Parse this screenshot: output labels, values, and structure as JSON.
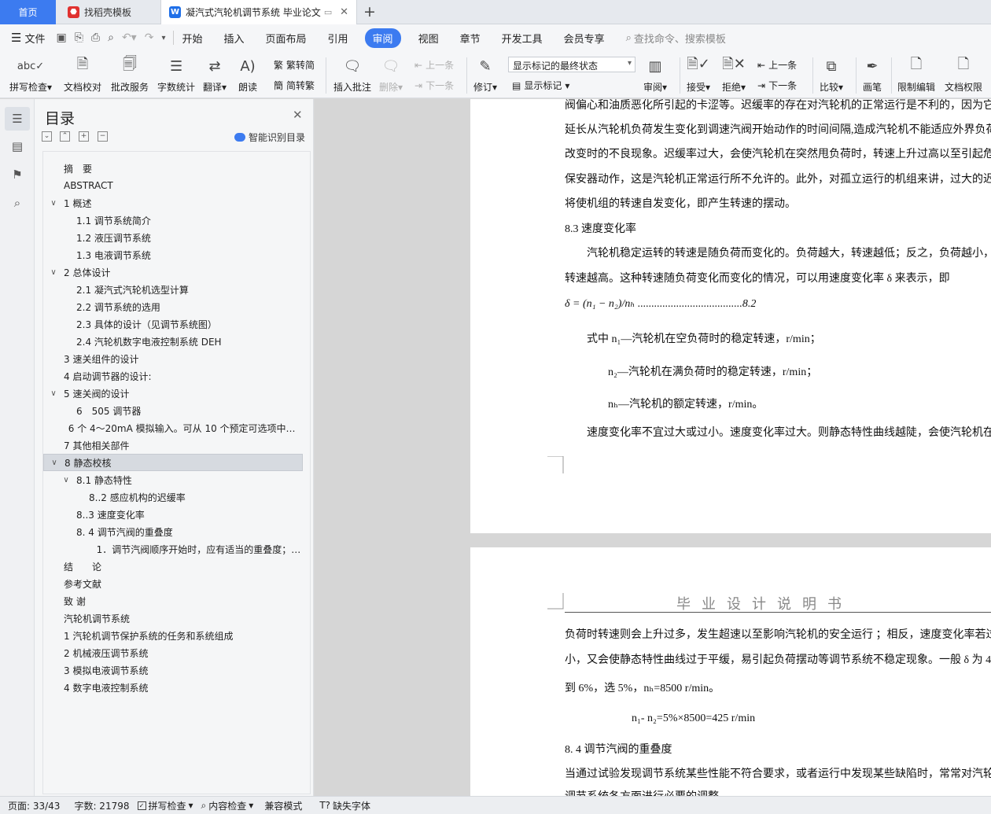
{
  "tabs": [
    {
      "label": "首页"
    },
    {
      "label": "找稻壳模板"
    },
    {
      "label": "凝汽式汽轮机调节系统 毕业论文"
    }
  ],
  "menu": {
    "file_label": "文件",
    "items": [
      "开始",
      "插入",
      "页面布局",
      "引用",
      "审阅",
      "视图",
      "章节",
      "开发工具",
      "会员专享"
    ],
    "active": "审阅",
    "search_placeholder": "查找命令、搜索模板"
  },
  "ribbon": {
    "spellcheck": "拼写检查",
    "doc_check": "文档校对",
    "batch_service": "批改服务",
    "word_count": "字数统计",
    "translate": "翻译",
    "read_aloud": "朗读",
    "trad_to_simp": "繁转简",
    "simp_to_trad": "简转繁",
    "insert_comment": "插入批注",
    "delete": "删除",
    "prev_comment": "上一条",
    "next_comment": "下一条",
    "track_changes": "修订",
    "display_mode": "显示标记的最终状态",
    "show_markup": "显示标记",
    "review": "审阅",
    "accept": "接受",
    "reject": "拒绝",
    "prev_change": "上一条",
    "next_change": "下一条",
    "compare": "比较",
    "pen": "画笔",
    "restrict_edit": "限制编辑",
    "doc_permission": "文档权限"
  },
  "toc": {
    "title": "目录",
    "smart_label": "智能识别目录",
    "items": [
      {
        "text": "摘　要",
        "level": 0,
        "chevron": ""
      },
      {
        "text": "ABSTRACT",
        "level": 0,
        "chevron": ""
      },
      {
        "text": "1  概述",
        "level": 0,
        "chevron": "v"
      },
      {
        "text": "1.1 调节系统简介",
        "level": 1,
        "chevron": ""
      },
      {
        "text": "1.2 液压调节系统",
        "level": 1,
        "chevron": ""
      },
      {
        "text": "1.3 电液调节系统",
        "level": 1,
        "chevron": ""
      },
      {
        "text": "2  总体设计",
        "level": 0,
        "chevron": "v"
      },
      {
        "text": "2.1 凝汽式汽轮机选型计算",
        "level": 1,
        "chevron": ""
      },
      {
        "text": "2.2 调节系统的选用",
        "level": 1,
        "chevron": ""
      },
      {
        "text": "2.3 具体的设计（见调节系统图）",
        "level": 1,
        "chevron": ""
      },
      {
        "text": "2.4 汽轮机数字电液控制系统 DEH",
        "level": 1,
        "chevron": ""
      },
      {
        "text": "3 速关组件的设计",
        "level": 0,
        "chevron": ""
      },
      {
        "text": "4 启动调节器的设计:",
        "level": 0,
        "chevron": ""
      },
      {
        "text": "5 速关阀的设计",
        "level": 0,
        "chevron": "v"
      },
      {
        "text": "6　505 调节器",
        "level": 1,
        "chevron": ""
      },
      {
        "text": "6 个 4～20mA 模拟输入。可从 10 个预定可选项中选择...",
        "level": 0.4,
        "chevron": ""
      },
      {
        "text": "7  其他相关部件",
        "level": 0,
        "chevron": ""
      },
      {
        "text": "8 静态校核",
        "level": 0,
        "chevron": "v"
      },
      {
        "text": "8.1 静态特性",
        "level": 1,
        "chevron": "v"
      },
      {
        "text": "8..2 感应机构的迟缓率",
        "level": 2,
        "chevron": ""
      },
      {
        "text": "8..3 速度变化率",
        "level": 1,
        "chevron": ""
      },
      {
        "text": "8. 4 调节汽阀的重叠度",
        "level": 1,
        "chevron": ""
      },
      {
        "text": "1．调节汽阀顺序开始时，应有适当的重叠度； ...",
        "level": 2.6,
        "chevron": ""
      },
      {
        "text": "结　　论",
        "level": 0,
        "chevron": ""
      },
      {
        "text": "参考文献",
        "level": 0,
        "chevron": ""
      },
      {
        "text": "致  谢",
        "level": 0,
        "chevron": ""
      },
      {
        "text": "汽轮机调节系统",
        "level": 0,
        "chevron": ""
      },
      {
        "text": "1 汽轮机调节保护系统的任务和系统组成",
        "level": 0,
        "chevron": ""
      },
      {
        "text": "2 机械液压调节系统",
        "level": 0,
        "chevron": ""
      },
      {
        "text": "3 模拟电液调节系统",
        "level": 0,
        "chevron": ""
      },
      {
        "text": "4  数字电液控制系统",
        "level": 0,
        "chevron": ""
      }
    ],
    "selected_index": 17
  },
  "page1": {
    "lines": [
      "阀偏心和油质恶化所引起的卡涩等。迟缓率的存在对汽轮机的正常运行是不利的，因为它会",
      "延长从汽轮机负荷发生变化到调速汽阀开始动作的时间间隔,造成汽轮机不能适应外界负荷",
      "改变时的不良现象。迟缓率过大，会使汽轮机在突然甩负荷时，转速上升过高以至引起危急",
      "保安器动作，这是汽轮机正常运行所不允许的。此外，对孤立运行的机组来讲，过大的迟缓",
      "将使机组的转速自发变化，即产生转速的摆动。"
    ],
    "heading_83": "8.3 速度变化率",
    "para_83_1": "汽轮机稳定运转的转速是随负荷而变化的。负荷越大，转速越低；反之，负荷越小，则",
    "para_83_2": "转速越高。这种转速随负荷变化而变化的情况，可以用速度变化率 δ 来表示，即",
    "formula": "δ = (n₁ − n₂)/nₕ ......................................8.2",
    "where_1": "式中 n₁—汽轮机在空负荷时的稳定转速，r/min；",
    "where_2": "n₂—汽轮机在满负荷时的稳定转速，r/min；",
    "where_3": "nₕ—汽轮机的额定转速，r/min。",
    "last_line": "速度变化率不宜过大或过小。速度变化率过大。则静态特性曲线越陡，会使汽轮机在扩"
  },
  "page2": {
    "header": "毕业设计说明书",
    "line_1": "负荷时转速则会上升过多，发生超速以至影响汽轮机的安全运行 ；相反，速度变化率若过",
    "line_2": "小，又会使静态特性曲线过于平缓，易引起负荷摆动等调节系统不稳定现象。一般 δ 为 4",
    "line_3": "到 6%，选 5%，nₕ=8500 r/min。",
    "formula": "n₁- n₂=5%×8500=425 r/min",
    "heading_84": "8. 4 调节汽阀的重叠度",
    "line_4": "当通过试验发现调节系统某些性能不符合要求，或者运行中发现某些缺陷时，常常对汽轮",
    "line_5": "调节系统各方面进行必要的调整"
  },
  "status": {
    "page": "页面: 33/43",
    "words": "字数: 21798",
    "spellcheck": "拼写检查",
    "content_check": "内容检查",
    "compat_mode": "兼容模式",
    "missing_font": "缺失字体"
  },
  "colors": {
    "accent": "#3c7bf0",
    "tab_home_bg": "#3c7bf0",
    "wps_red": "#e0312f"
  }
}
